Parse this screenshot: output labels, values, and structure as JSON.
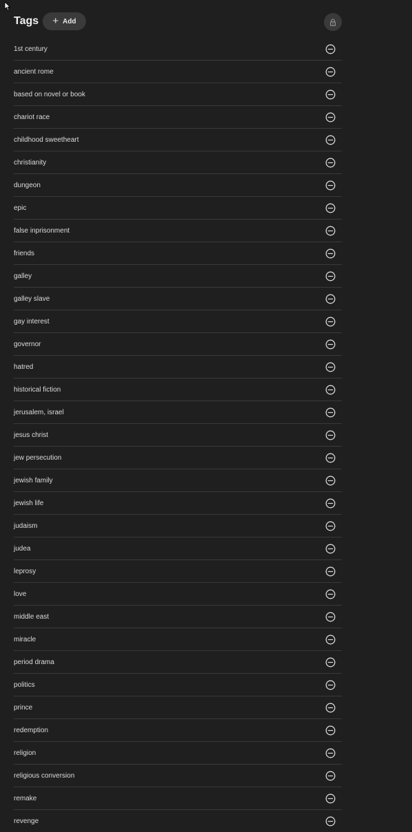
{
  "header": {
    "title": "Tags",
    "add_label": "Add",
    "add_icon": "plus-icon",
    "lock_icon": "lock-icon"
  },
  "tags": [
    {
      "label": "1st century"
    },
    {
      "label": "ancient rome"
    },
    {
      "label": "based on novel or book"
    },
    {
      "label": "chariot race"
    },
    {
      "label": "childhood sweetheart"
    },
    {
      "label": "christianity"
    },
    {
      "label": "dungeon"
    },
    {
      "label": "epic"
    },
    {
      "label": "false inprisonment"
    },
    {
      "label": "friends"
    },
    {
      "label": "galley"
    },
    {
      "label": "galley slave"
    },
    {
      "label": "gay interest"
    },
    {
      "label": "governor"
    },
    {
      "label": "hatred"
    },
    {
      "label": "historical fiction"
    },
    {
      "label": "jerusalem, israel"
    },
    {
      "label": "jesus christ"
    },
    {
      "label": "jew persecution"
    },
    {
      "label": "jewish family"
    },
    {
      "label": "jewish life"
    },
    {
      "label": "judaism"
    },
    {
      "label": "judea"
    },
    {
      "label": "leprosy"
    },
    {
      "label": "love"
    },
    {
      "label": "middle east"
    },
    {
      "label": "miracle"
    },
    {
      "label": "period drama"
    },
    {
      "label": "politics"
    },
    {
      "label": "prince"
    },
    {
      "label": "redemption"
    },
    {
      "label": "religion"
    },
    {
      "label": "religious conversion"
    },
    {
      "label": "remake"
    },
    {
      "label": "revenge"
    }
  ],
  "remove_icon": "minus-circle-icon",
  "colors": {
    "background": "#1f1f1f",
    "button_bg": "#3a3a3a",
    "divider": "#3a3a3a",
    "text": "#dcdcdc"
  }
}
